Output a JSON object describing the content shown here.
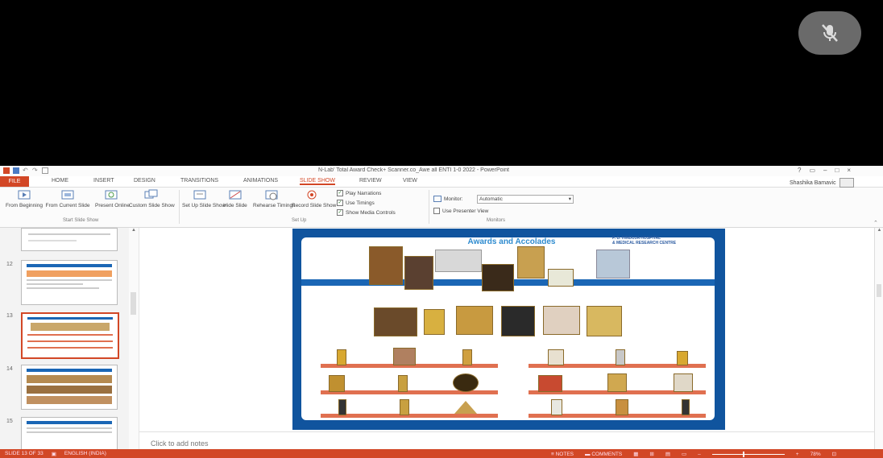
{
  "app": {
    "title": "N-Lab' Total Award Check+ Scanner.co_Awe all ENTI 1-0 2022 - PowerPoint",
    "file_tab": "FILE",
    "tabs": [
      "HOME",
      "INSERT",
      "DESIGN",
      "TRANSITIONS",
      "ANIMATIONS",
      "SLIDE SHOW",
      "REVIEW",
      "VIEW"
    ],
    "active_tab": "SLIDE SHOW",
    "user": "Shashika Bamavic"
  },
  "ribbon": {
    "from_beginning": "From Beginning",
    "from_current": "From Current Slide",
    "present_online": "Present Online",
    "custom_slide_show": "Custom Slide Show",
    "group_start": "Start Slide Show",
    "set_up": "Set Up Slide Show",
    "hide_slide": "Hide Slide",
    "rehearse": "Rehearse Timings",
    "record": "Record Slide Show",
    "group_setup": "Set Up",
    "play_narrations": "Play Narrations",
    "use_timings": "Use Timings",
    "show_media_controls": "Show Media Controls",
    "monitor_label": "Monitor:",
    "monitor_value": "Automatic",
    "presenter_view": "Use Presenter View",
    "group_monitors": "Monitors"
  },
  "thumbnails": [
    {
      "num": ""
    },
    {
      "num": "12"
    },
    {
      "num": "13"
    },
    {
      "num": "14"
    },
    {
      "num": "15"
    }
  ],
  "slide": {
    "title": "Awards and Accolades",
    "logo_line1": "P. D. HINDUJA HOSPITAL",
    "logo_line2": "& MEDICAL RESEARCH CENTRE"
  },
  "notes_placeholder": "Click to add notes",
  "status": {
    "slide_info": "SLIDE 13 OF 33",
    "language": "ENGLISH (INDIA)",
    "notes": "NOTES",
    "comments": "COMMENTS",
    "zoom": "78%"
  },
  "colors": {
    "accent": "#d24726",
    "slide_blue": "#10549e",
    "title_blue": "#2e8bcf"
  }
}
